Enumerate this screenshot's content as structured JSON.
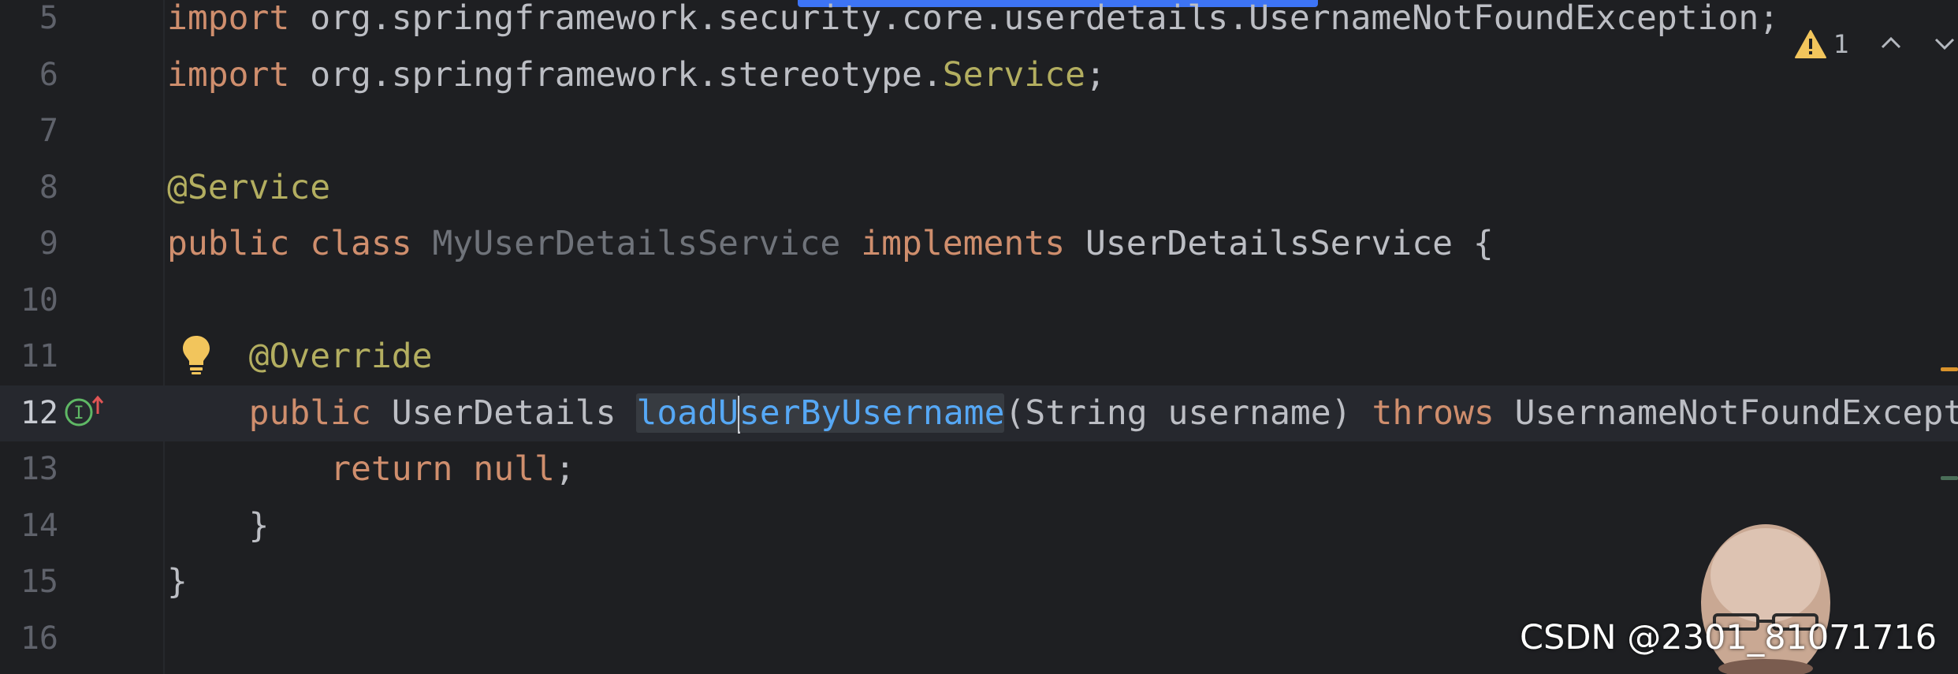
{
  "editor": {
    "lines": [
      {
        "number": "5",
        "tokens": [
          {
            "t": "import",
            "c": "kw"
          },
          {
            "t": " org.springframework.security.core.userdetails.UsernameNotFoundException;",
            "c": "cls"
          }
        ]
      },
      {
        "number": "6",
        "tokens": [
          {
            "t": "import",
            "c": "kw"
          },
          {
            "t": " org.springframework.stereotype.",
            "c": "cls"
          },
          {
            "t": "Service",
            "c": "ann"
          },
          {
            "t": ";",
            "c": "cls"
          }
        ]
      },
      {
        "number": "7",
        "tokens": []
      },
      {
        "number": "8",
        "tokens": [
          {
            "t": "@Service",
            "c": "ann"
          }
        ]
      },
      {
        "number": "9",
        "tokens": [
          {
            "t": "public class ",
            "c": "kw"
          },
          {
            "t": "MyUserDetailsService",
            "c": "unused"
          },
          {
            "t": " ",
            "c": "cls"
          },
          {
            "t": "implements",
            "c": "kw"
          },
          {
            "t": " UserDetailsService {",
            "c": "cls"
          }
        ]
      },
      {
        "number": "10",
        "tokens": []
      },
      {
        "number": "11",
        "tokens": [
          {
            "t": "    ",
            "c": "cls"
          },
          {
            "t": "@Override",
            "c": "ann"
          }
        ]
      },
      {
        "number": "12",
        "current": true,
        "tokens": [
          {
            "t": "    ",
            "c": "cls"
          },
          {
            "t": "public",
            "c": "kw"
          },
          {
            "t": " UserDetails ",
            "c": "cls"
          },
          {
            "t": "loadU",
            "c": "method"
          },
          {
            "t": "",
            "c": "caret"
          },
          {
            "t": "serByUsername",
            "c": "method"
          },
          {
            "t": "(String username) ",
            "c": "cls"
          },
          {
            "t": "throws",
            "c": "kw"
          },
          {
            "t": " UsernameNotFoundException {",
            "c": "cls"
          }
        ]
      },
      {
        "number": "13",
        "tokens": [
          {
            "t": "        ",
            "c": "cls"
          },
          {
            "t": "return null",
            "c": "kw"
          },
          {
            "t": ";",
            "c": "cls"
          }
        ]
      },
      {
        "number": "14",
        "tokens": [
          {
            "t": "    }",
            "c": "cls"
          }
        ]
      },
      {
        "number": "15",
        "tokens": [
          {
            "t": "}",
            "c": "cls"
          }
        ]
      },
      {
        "number": "16",
        "tokens": []
      }
    ]
  },
  "inspection_widget": {
    "warning_count": "1",
    "icons": [
      "warning-icon",
      "chevron-up-icon",
      "chevron-down-icon"
    ]
  },
  "gutter_icons": [
    "intention-bulb-icon",
    "implements-method-icon"
  ],
  "watermark": {
    "text": "CSDN @2301_81071716"
  },
  "colors": {
    "background": "#1e1f22",
    "keyword": "#cf8e6d",
    "annotation": "#b3ae60",
    "method": "#56a8f5",
    "text": "#bcbec4",
    "unused": "#6f737a",
    "scroll_indicator": "#3d74f5"
  }
}
